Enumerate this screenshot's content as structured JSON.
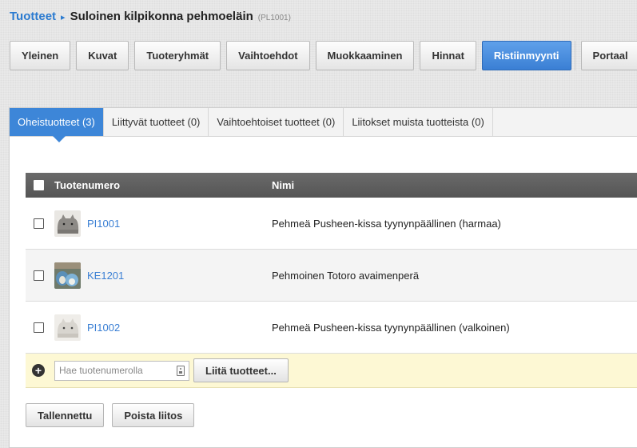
{
  "breadcrumb": {
    "root": "Tuotteet",
    "separator": "▸",
    "title": "Suloinen kilpikonna pehmoeläin",
    "code": "(PL1001)"
  },
  "main_tabs": [
    {
      "label": "Yleinen"
    },
    {
      "label": "Kuvat"
    },
    {
      "label": "Tuoteryhmät"
    },
    {
      "label": "Vaihtoehdot"
    },
    {
      "label": "Muokkaaminen"
    },
    {
      "label": "Hinnat"
    },
    {
      "label": "Ristiinmyynti",
      "active": true
    },
    {
      "label": "Portaal"
    }
  ],
  "sub_tabs": [
    {
      "label": "Oheistuotteet (3)",
      "active": true
    },
    {
      "label": "Liittyvät tuotteet (0)"
    },
    {
      "label": "Vaihtoehtoiset tuotteet (0)"
    },
    {
      "label": "Liitokset muista tuotteista (0)"
    }
  ],
  "table": {
    "headers": {
      "number": "Tuotenumero",
      "name": "Nimi"
    },
    "rows": [
      {
        "number": "PI1001",
        "name": "Pehmeä Pusheen-kissa tyynynpäällinen (harmaa)"
      },
      {
        "number": "KE1201",
        "name": "Pehmoinen Totoro avaimenperä"
      },
      {
        "number": "PI1002",
        "name": "Pehmeä Pusheen-kissa tyynynpäällinen (valkoinen)"
      }
    ]
  },
  "add_row": {
    "search_placeholder": "Hae tuotenumerolla",
    "attach_label": "Liitä tuotteet..."
  },
  "footer": {
    "save_label": "Tallennettu",
    "remove_label": "Poista liitos"
  },
  "colors": {
    "accent": "#3d86d8",
    "add_row_bg": "#fdf8d4",
    "header_bg": "#5f5f5f"
  }
}
